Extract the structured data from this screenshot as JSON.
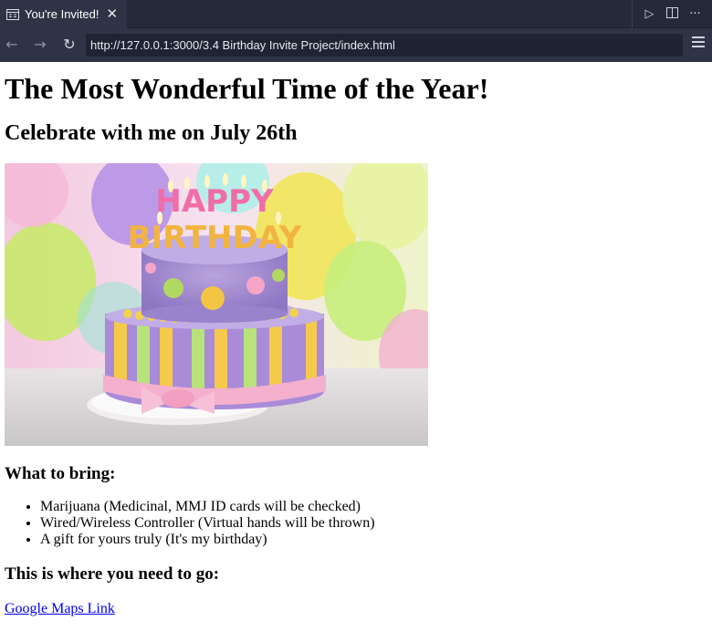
{
  "browser": {
    "tab_title": "You're Invited!",
    "tab_close_icon": "close-icon",
    "url": "http://127.0.0.1:3000/3.4 Birthday Invite Project/index.html",
    "icons": {
      "back": "arrow-left-icon",
      "forward": "arrow-right-icon",
      "refresh": "refresh-icon",
      "run": "play-icon",
      "split": "split-view-icon",
      "more": "more-icon",
      "menu": "hamburger-menu-icon"
    }
  },
  "page": {
    "heading": "The Most Wonderful Time of the Year!",
    "subheading": "Celebrate with me on July 26th",
    "image": {
      "cake_text_line1": "HAPPY",
      "cake_text_line2": "BIRTHDAY"
    },
    "bring_heading": "What to bring:",
    "bring_items": [
      "Marijuana (Medicinal, MMJ ID cards will be checked)",
      "Wired/Wireless Controller (Virtual hands will be thrown)",
      "A gift for yours truly (It's my birthday)"
    ],
    "location_heading": "This is where you need to go:",
    "map_link_text": "Google Maps Link"
  },
  "colors": {
    "chrome_bg": "#2e3446",
    "link": "#0000ee"
  }
}
